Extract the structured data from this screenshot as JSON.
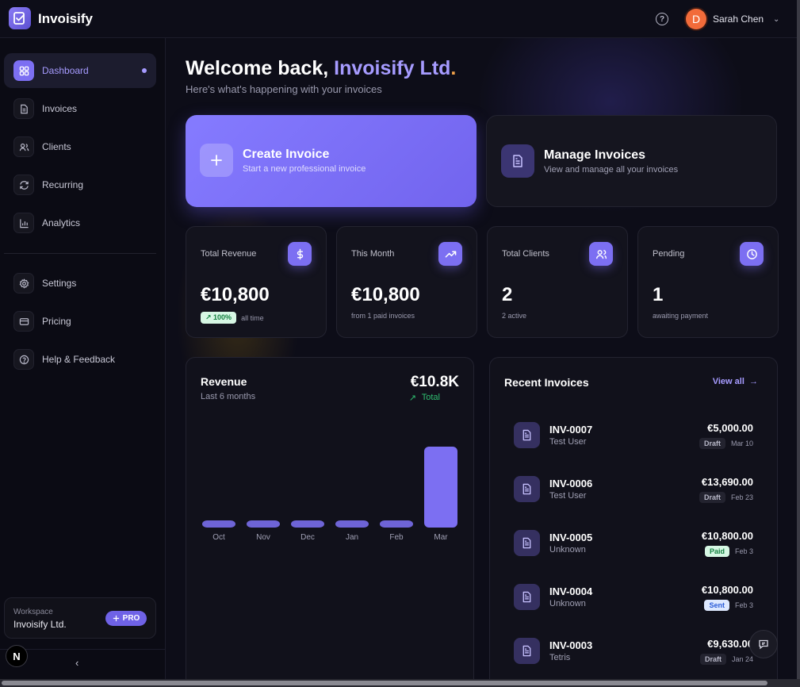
{
  "app": {
    "brand": "Invoisify"
  },
  "header": {
    "help_symbol": "?",
    "user_initial": "D",
    "user_name": "Sarah Chen",
    "user_menu_symbol": "⌄"
  },
  "sidebar": {
    "items": [
      {
        "label": "Dashboard",
        "icon": "dashboard-icon",
        "active": true
      },
      {
        "label": "Invoices",
        "icon": "file-icon"
      },
      {
        "label": "Clients",
        "icon": "users-icon"
      },
      {
        "label": "Recurring",
        "icon": "refresh-icon"
      },
      {
        "label": "Analytics",
        "icon": "bar-chart-icon"
      },
      {
        "label": "Settings",
        "icon": "gear-icon"
      },
      {
        "label": "Pricing",
        "icon": "card-icon"
      },
      {
        "label": "Help & Feedback",
        "icon": "help-circle-icon"
      }
    ],
    "workspace_label": "Workspace",
    "workspace_name": "Invoisify Ltd.",
    "plan_badge": "PRO",
    "n_badge": "N",
    "collapse_symbol": "‹"
  },
  "welcome": {
    "prefix": "Welcome back, ",
    "company": "Invoisify Ltd",
    "dot": ".",
    "subtitle": "Here's what's happening with your invoices"
  },
  "actions": {
    "create": {
      "title": "Create Invoice",
      "subtitle": "Start a new professional invoice"
    },
    "manage": {
      "title": "Manage Invoices",
      "subtitle": "View and manage all your invoices"
    }
  },
  "stats": [
    {
      "label": "Total Revenue",
      "value": "€10,800",
      "pill": "↗ 100%",
      "sub": "all time",
      "icon": "dollar-icon"
    },
    {
      "label": "This Month",
      "value": "€10,800",
      "sub": "from 1 paid invoices",
      "icon": "trending-up-icon"
    },
    {
      "label": "Total Clients",
      "value": "2",
      "sub": "2 active",
      "icon": "users-icon"
    },
    {
      "label": "Pending",
      "value": "1",
      "sub": "awaiting payment",
      "icon": "clock-icon"
    }
  ],
  "revenue": {
    "title": "Revenue",
    "subtitle": "Last 6 months",
    "total": "€10.8K",
    "trend_symbol": "↗",
    "total_label": "Total"
  },
  "chart_data": {
    "type": "bar",
    "categories": [
      "Oct",
      "Nov",
      "Dec",
      "Jan",
      "Feb",
      "Mar"
    ],
    "values": [
      0,
      0,
      0,
      0,
      0,
      10800
    ],
    "title": "Revenue",
    "subtitle": "Last 6 months",
    "bar_color": "#7c6ff2",
    "grid": false
  },
  "recent": {
    "title": "Recent Invoices",
    "view_all": "View all",
    "view_all_symbol": "→",
    "invoices": [
      {
        "id": "INV-0007",
        "client": "Test User",
        "amount": "€5,000.00",
        "status": "Draft",
        "date": "Mar 10"
      },
      {
        "id": "INV-0006",
        "client": "Test User",
        "amount": "€13,690.00",
        "status": "Draft",
        "date": "Feb 23"
      },
      {
        "id": "INV-0005",
        "client": "Unknown",
        "amount": "€10,800.00",
        "status": "Paid",
        "date": "Feb 3"
      },
      {
        "id": "INV-0004",
        "client": "Unknown",
        "amount": "€10,800.00",
        "status": "Sent",
        "date": "Feb 3"
      },
      {
        "id": "INV-0003",
        "client": "Tetris",
        "amount": "€9,630.00",
        "status": "Draft",
        "date": "Jan 24"
      }
    ]
  },
  "colors": {
    "accent": "#7c6ff2",
    "accent_light": "#a69bff",
    "brand_dot": "#f2a24a",
    "success": "#2fbf71",
    "avatar": "#f26b3a"
  }
}
